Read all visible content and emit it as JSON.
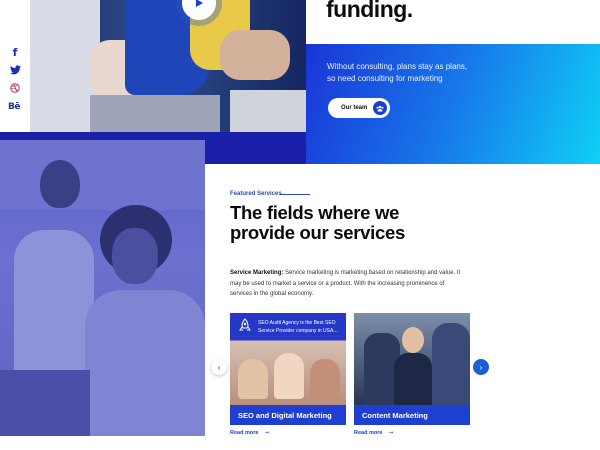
{
  "colors": {
    "brand_blue": "#1e3fcf",
    "gradient_start": "#1a35d6",
    "gradient_end": "#0fd0f5",
    "photo_tint": "#5d64c4"
  },
  "social": {
    "facebook": {
      "icon": "facebook-icon",
      "glyph": "f"
    },
    "twitter": {
      "icon": "twitter-icon"
    },
    "dribbble": {
      "icon": "dribbble-icon"
    },
    "behance": {
      "icon": "behance-icon",
      "glyph": "Bē"
    }
  },
  "hero": {
    "headline": "funding.",
    "play_icon": "play-icon",
    "tagline_line1": "Without consulting, plans stay as plans,",
    "tagline_line2": "so need consulting for marketing",
    "team_button": "Our team",
    "team_button_icon": "team-icon"
  },
  "services": {
    "eyebrow": "Featured Services",
    "heading": "The fields where we provide our services",
    "body_label": "Service Marketing:",
    "body_text": " Service marketing is marketing based on relationship and value. It may be used to market a service or a product. With the increasing prominence of services in the global economy.",
    "cards": [
      {
        "title": "SEO and Digital Marketing",
        "image_caption": "SEO Audit Agency is the Best SEO Service Provider company in USA...",
        "read_more": "Read more"
      },
      {
        "title": "Content Marketing",
        "read_more": "Read more"
      }
    ],
    "prev_arrow": "‹",
    "next_arrow": "›"
  }
}
